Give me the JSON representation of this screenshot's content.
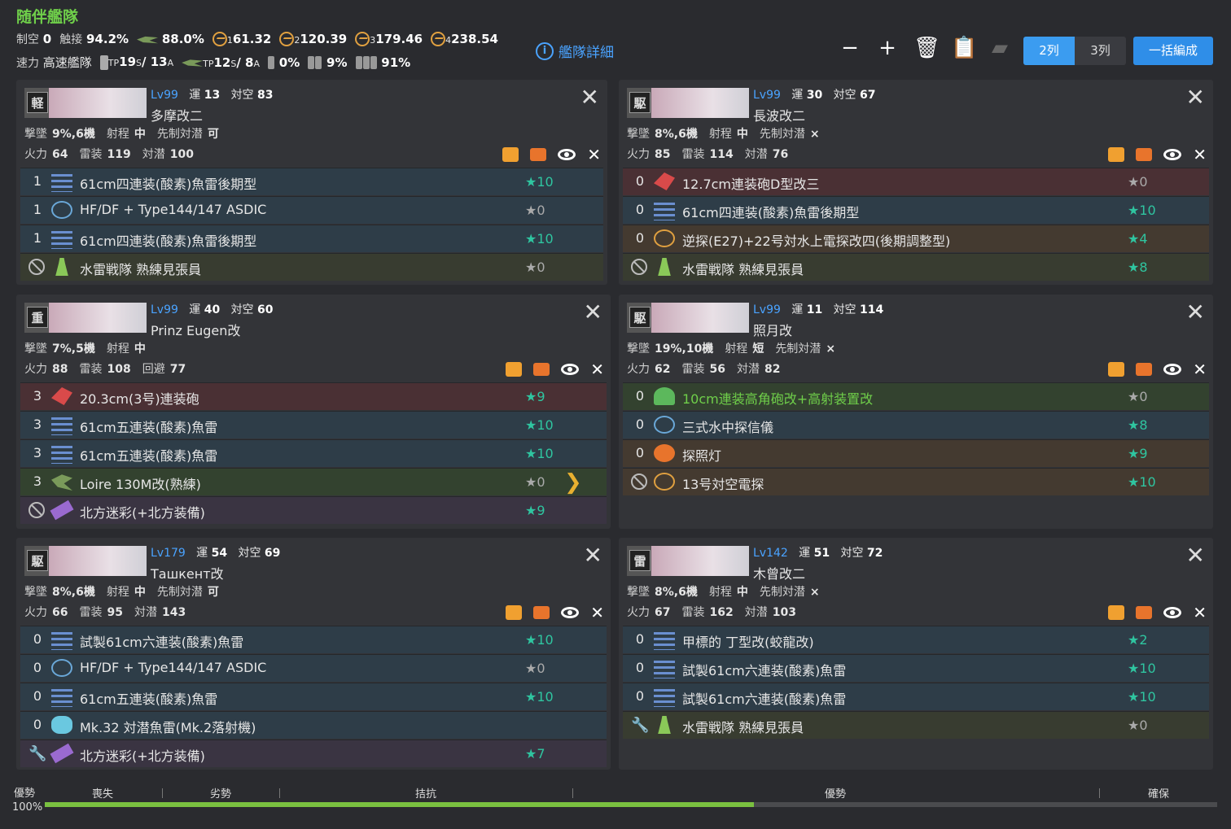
{
  "header": {
    "title": "随伴艦隊",
    "air_label": "制空",
    "air_val": "0",
    "contact_label": "触接",
    "contact_val": "94.2%",
    "night_val": "88.0%",
    "los1": "61.32",
    "los2": "120.39",
    "los3": "179.46",
    "los4": "238.54",
    "los_idx": [
      "1",
      "2",
      "3",
      "4"
    ],
    "speed_label": "速力",
    "speed_val": "高速艦隊",
    "tp_label": "TP",
    "tp_s": "19",
    "tp_a": "13",
    "tp2_s": "12",
    "tp2_a": "8",
    "tp_sub_s": "S",
    "tp_sub_a": "A",
    "tp_sep": "/ ",
    "drum1": "0%",
    "drum2": "9%",
    "drum3": "91%"
  },
  "detail_label": "艦隊詳細",
  "view": {
    "col2": "2列",
    "col3": "3列",
    "bulk": "一括編成"
  },
  "labels": {
    "luck": "運",
    "aa": "対空",
    "shotdown": "撃墜",
    "range": "射程",
    "opasw": "先制対潜",
    "fp": "火力",
    "torp": "雷装",
    "asw": "対潜",
    "evasion": "回避"
  },
  "ships": [
    {
      "type": "軽",
      "lv": "Lv99",
      "luck": "13",
      "aa": "83",
      "name": "多摩改二",
      "shotdown": "9%,6機",
      "range": "中",
      "opasw_label": "先制対潜",
      "opasw": "可",
      "fp": "64",
      "torp": "119",
      "third_label": "対潜",
      "third": "100",
      "equip": [
        {
          "slot": "1",
          "name": "61cm四連装(酸素)魚雷後期型",
          "star": "★10"
        },
        {
          "slot": "1",
          "name": "HF/DF + Type144/147 ASDIC",
          "star": "★0"
        },
        {
          "slot": "1",
          "name": "61cm四連装(酸素)魚雷後期型",
          "star": "★10"
        },
        {
          "slot": "",
          "name": "水雷戦隊 熟練見張員",
          "star": "★0"
        }
      ]
    },
    {
      "type": "駆",
      "lv": "Lv99",
      "luck": "30",
      "aa": "67",
      "name": "長波改二",
      "shotdown": "8%,6機",
      "range": "中",
      "opasw_label": "先制対潜",
      "opasw": "×",
      "fp": "85",
      "torp": "114",
      "third_label": "対潜",
      "third": "76",
      "equip": [
        {
          "slot": "0",
          "name": "12.7cm連装砲D型改三",
          "star": "★0"
        },
        {
          "slot": "0",
          "name": "61cm四連装(酸素)魚雷後期型",
          "star": "★10"
        },
        {
          "slot": "0",
          "name": "逆探(E27)+22号対水上電探改四(後期調整型)",
          "star": "★4"
        },
        {
          "slot": "",
          "name": "水雷戦隊 熟練見張員",
          "star": "★8"
        }
      ]
    },
    {
      "type": "重",
      "lv": "Lv99",
      "luck": "40",
      "aa": "60",
      "name": "Prinz Eugen改",
      "shotdown": "7%,5機",
      "range": "中",
      "opasw_label": "",
      "opasw": "",
      "fp": "88",
      "torp": "108",
      "third_label": "回避",
      "third": "77",
      "equip": [
        {
          "slot": "3",
          "name": "20.3cm(3号)連装砲",
          "star": "★9"
        },
        {
          "slot": "3",
          "name": "61cm五連装(酸素)魚雷",
          "star": "★10"
        },
        {
          "slot": "3",
          "name": "61cm五連装(酸素)魚雷",
          "star": "★10"
        },
        {
          "slot": "3",
          "name": "Loire 130M改(熟練)",
          "star": "★0"
        },
        {
          "slot": "",
          "name": "北方迷彩(+北方装備)",
          "star": "★9"
        }
      ]
    },
    {
      "type": "駆",
      "lv": "Lv99",
      "luck": "11",
      "aa": "114",
      "name": "照月改",
      "shotdown": "19%,10機",
      "range": "短",
      "opasw_label": "先制対潜",
      "opasw": "×",
      "fp": "62",
      "torp": "56",
      "third_label": "対潜",
      "third": "82",
      "equip": [
        {
          "slot": "0",
          "name": "10cm連装高角砲改+高射装置改",
          "star": "★0"
        },
        {
          "slot": "0",
          "name": "三式水中探信儀",
          "star": "★8"
        },
        {
          "slot": "0",
          "name": "探照灯",
          "star": "★9"
        },
        {
          "slot": "",
          "name": "13号対空電探",
          "star": "★10"
        }
      ]
    },
    {
      "type": "駆",
      "lv": "Lv179",
      "luck": "54",
      "aa": "69",
      "name": "Ташкент改",
      "shotdown": "8%,6機",
      "range": "中",
      "opasw_label": "先制対潜",
      "opasw": "可",
      "fp": "66",
      "torp": "95",
      "third_label": "対潜",
      "third": "143",
      "equip": [
        {
          "slot": "0",
          "name": "試製61cm六連装(酸素)魚雷",
          "star": "★10"
        },
        {
          "slot": "0",
          "name": "HF/DF + Type144/147 ASDIC",
          "star": "★0"
        },
        {
          "slot": "0",
          "name": "61cm五連装(酸素)魚雷",
          "star": "★10"
        },
        {
          "slot": "0",
          "name": "Mk.32 対潜魚雷(Mk.2落射機)",
          "star": ""
        },
        {
          "slot": "",
          "name": "北方迷彩(+北方装備)",
          "star": "★7"
        }
      ]
    },
    {
      "type": "雷",
      "lv": "Lv142",
      "luck": "51",
      "aa": "72",
      "name": "木曾改二",
      "shotdown": "8%,6機",
      "range": "中",
      "opasw_label": "先制対潜",
      "opasw": "×",
      "fp": "67",
      "torp": "162",
      "third_label": "対潜",
      "third": "103",
      "equip": [
        {
          "slot": "0",
          "name": "甲標的 丁型改(蛟龍改)",
          "star": "★2"
        },
        {
          "slot": "0",
          "name": "試製61cm六連装(酸素)魚雷",
          "star": "★10"
        },
        {
          "slot": "0",
          "name": "試製61cm六連装(酸素)魚雷",
          "star": "★10"
        },
        {
          "slot": "",
          "name": "水雷戦隊 熟練見張員",
          "star": "★0"
        }
      ]
    }
  ],
  "gauge": {
    "left_label": "優勢",
    "pct": "100%",
    "fill": 0.605,
    "stages": [
      "喪失",
      "劣勢",
      "拮抗",
      "優勢",
      "確保"
    ]
  }
}
